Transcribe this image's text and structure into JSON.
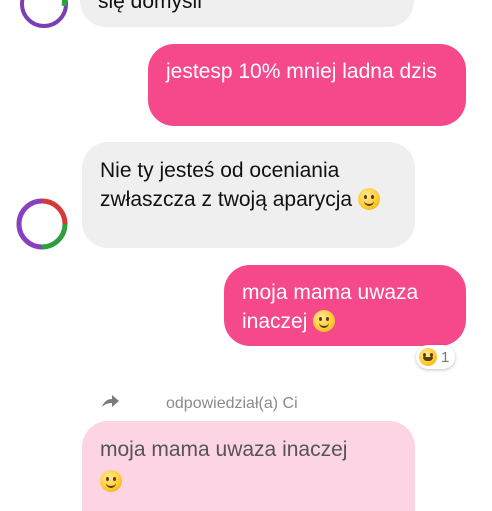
{
  "messages": [
    {
      "id": "m0",
      "direction": "incoming",
      "text": "się domyśli"
    },
    {
      "id": "m1",
      "direction": "outgoing",
      "text": "jestesp 10% mniej ladna dzis"
    },
    {
      "id": "m2",
      "direction": "incoming",
      "text": "Nie ty jesteś od oceniania zwłaszcza z twoją aparycja",
      "emoji": "slightly-smiling-face"
    },
    {
      "id": "m3",
      "direction": "outgoing",
      "text": "moja mama uwaza inaczej",
      "emoji": "slightly-smiling-face",
      "reaction": {
        "emoji": "laughing-face",
        "count": "1"
      }
    }
  ],
  "reply": {
    "label": "odpowiedział(a) Ci",
    "icon": "reply-arrow-icon",
    "quoted_text": "moja mama uwaza inaczej",
    "quoted_emoji": "slightly-smiling-face"
  },
  "colors": {
    "outgoing_bubble": "#f5498c",
    "incoming_bubble": "#efefef",
    "quoted_bubble": "#fcd4e4"
  }
}
